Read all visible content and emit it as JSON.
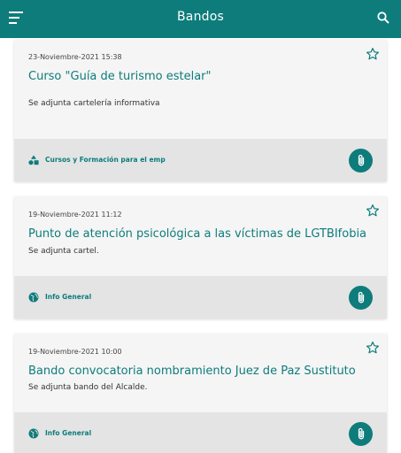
{
  "appbar": {
    "title": "Bandos"
  },
  "bandos": [
    {
      "date": "23-Noviembre-2021 15:38",
      "title": "Curso \"Guía de turismo estelar\"",
      "description": "Se adjunta cartelería informativa",
      "category": "Cursos y Formación para el emp",
      "category_icon": "shapes-icon"
    },
    {
      "date": "19-Noviembre-2021 11:12",
      "title": "Punto de atención psicológica a las víctimas de LGTBIfobia",
      "description": "Se adjunta cartel.",
      "category": "Info General",
      "category_icon": "globe-icon"
    },
    {
      "date": "19-Noviembre-2021 10:00",
      "title": "Bando convocatoria nombramiento Juez de Paz Sustituto",
      "description": "Se adjunta bando del Alcalde.",
      "category": "Info General",
      "category_icon": "globe-icon"
    }
  ],
  "colors": {
    "primary": "#0e7c7b",
    "card_bg": "#f5f5f5",
    "footer_bg": "#e4e4e4"
  }
}
